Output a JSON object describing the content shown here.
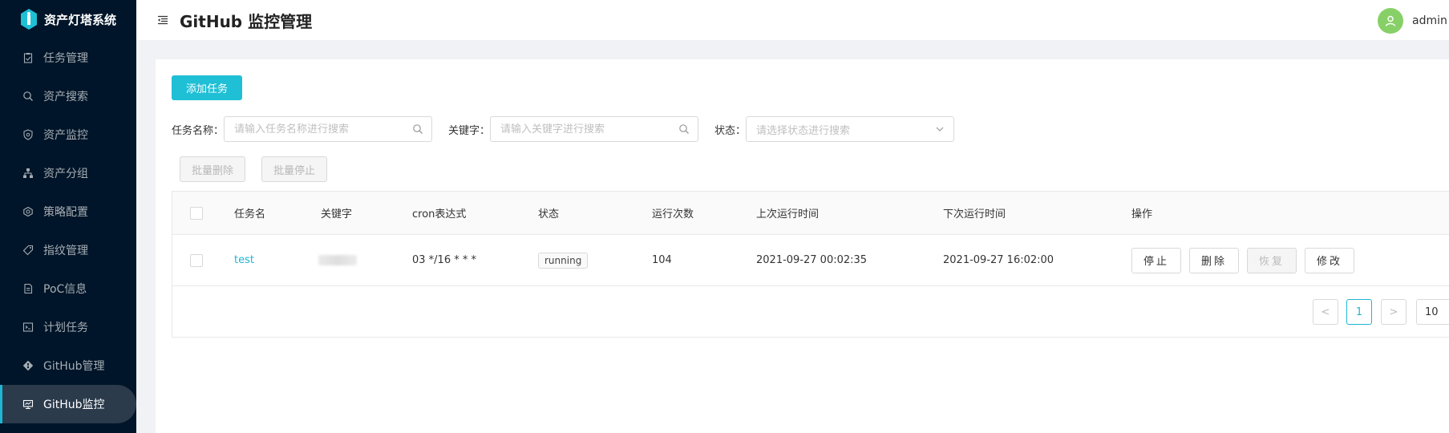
{
  "app": {
    "logo_text": "资产灯塔系统"
  },
  "sidebar": {
    "items": [
      {
        "label": "任务管理",
        "icon": "clipboard-icon",
        "active": false
      },
      {
        "label": "资产搜索",
        "icon": "search-icon",
        "active": false
      },
      {
        "label": "资产监控",
        "icon": "shield-icon",
        "active": false
      },
      {
        "label": "资产分组",
        "icon": "cluster-icon",
        "active": false
      },
      {
        "label": "策略配置",
        "icon": "gear-icon",
        "active": false
      },
      {
        "label": "指纹管理",
        "icon": "tag-icon",
        "active": false
      },
      {
        "label": "PoC信息",
        "icon": "document-icon",
        "active": false
      },
      {
        "label": "计划任务",
        "icon": "terminal-icon",
        "active": false
      },
      {
        "label": "GitHub管理",
        "icon": "git-icon",
        "active": false
      },
      {
        "label": "GitHub监控",
        "icon": "monitor-icon",
        "active": true
      }
    ]
  },
  "header": {
    "title": "GitHub 监控管理",
    "username": "admin"
  },
  "toolbar": {
    "add_label": "添加任务"
  },
  "filters": {
    "name_label": "任务名称：",
    "name_placeholder": "请输入任务名称进行搜索",
    "keyword_label": "关键字：",
    "keyword_placeholder": "请输入关键字进行搜索",
    "status_label": "状态：",
    "status_placeholder": "请选择状态进行搜索"
  },
  "batch": {
    "delete_label": "批量删除",
    "stop_label": "批量停止"
  },
  "table": {
    "columns": [
      "任务名",
      "关键字",
      "cron表达式",
      "状态",
      "运行次数",
      "上次运行时间",
      "下次运行时间",
      "操作"
    ],
    "rows": [
      {
        "name": "test",
        "keyword": "",
        "cron": "03 */16 * * *",
        "status": "running",
        "run_count": "104",
        "last_run": "2021-09-27 00:02:35",
        "next_run": "2021-09-27 16:02:00",
        "actions": [
          "停止",
          "删除",
          "恢复",
          "修改"
        ]
      }
    ]
  },
  "pagination": {
    "prev": "<",
    "current": "1",
    "next": ">",
    "page_size": "10"
  },
  "colors": {
    "accent": "#1fbfd6",
    "sidebar_bg": "#001529",
    "avatar": "#87d068"
  }
}
